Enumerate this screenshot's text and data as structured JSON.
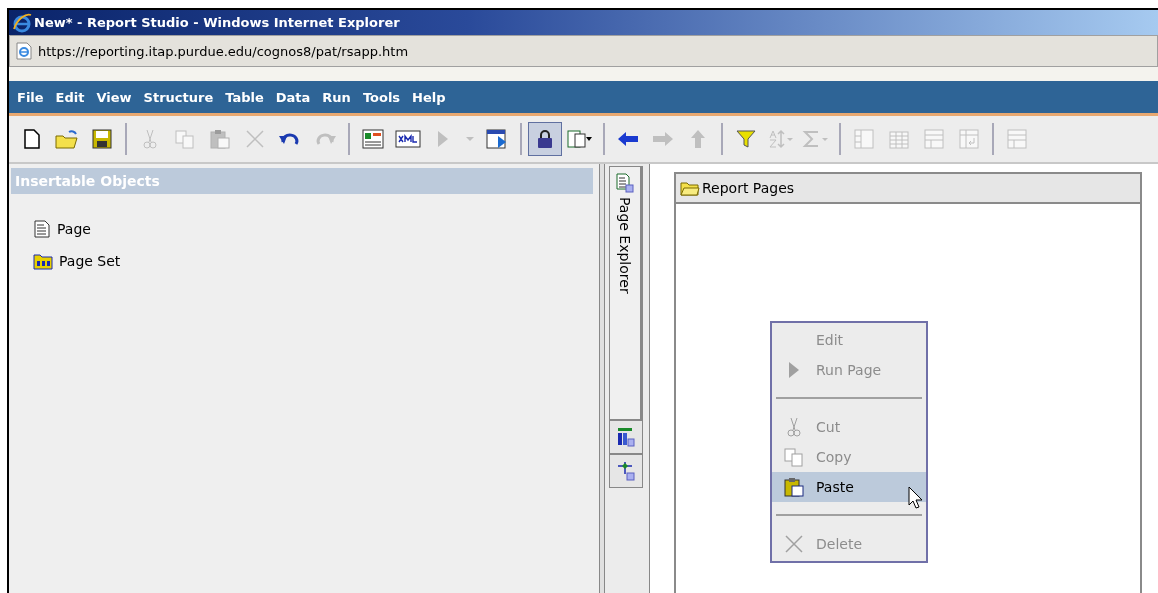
{
  "window": {
    "title": "New* - Report Studio - Windows Internet Explorer"
  },
  "address_bar": {
    "url": "https://reporting.itap.purdue.edu/cognos8/pat/rsapp.htm"
  },
  "menu_bar": [
    "File",
    "Edit",
    "View",
    "Structure",
    "Table",
    "Data",
    "Run",
    "Tools",
    "Help"
  ],
  "toolbar": [
    [
      {
        "kind": "new",
        "disabled": false
      },
      {
        "kind": "open",
        "disabled": false
      },
      {
        "kind": "save",
        "disabled": false
      }
    ],
    [
      {
        "kind": "cut",
        "disabled": true
      },
      {
        "kind": "copy",
        "disabled": true
      },
      {
        "kind": "paste",
        "disabled": true
      },
      {
        "kind": "delete",
        "disabled": true
      },
      {
        "kind": "undo",
        "disabled": false
      },
      {
        "kind": "redo",
        "disabled": true
      }
    ],
    [
      {
        "kind": "validate",
        "disabled": false
      },
      {
        "kind": "xml",
        "disabled": false
      },
      {
        "kind": "run",
        "disabled": true
      },
      {
        "kind": "dropdown",
        "disabled": true
      },
      {
        "kind": "view",
        "disabled": false
      }
    ],
    [
      {
        "kind": "lock",
        "disabled": false,
        "selected": true
      },
      {
        "kind": "layout",
        "disabled": false,
        "selected": false
      }
    ],
    [
      {
        "kind": "back",
        "disabled": false
      },
      {
        "kind": "forward",
        "disabled": true
      },
      {
        "kind": "up",
        "disabled": true
      }
    ],
    [
      {
        "kind": "filter",
        "disabled": false
      },
      {
        "kind": "sort",
        "disabled": true
      },
      {
        "kind": "sum",
        "disabled": true
      }
    ],
    [
      {
        "kind": "columns",
        "disabled": true
      },
      {
        "kind": "grid",
        "disabled": true
      },
      {
        "kind": "rows",
        "disabled": true
      },
      {
        "kind": "swap",
        "disabled": true
      }
    ],
    [
      {
        "kind": "rows",
        "disabled": true
      }
    ]
  ],
  "insertable_objects": {
    "title": "Insertable Objects",
    "items": [
      {
        "label": "Page",
        "kind": "page"
      },
      {
        "label": "Page Set",
        "kind": "pageset"
      }
    ]
  },
  "side_tabs": [
    {
      "label": "Page Explorer",
      "kind": "pages",
      "selected": true
    },
    {
      "kind": "queries",
      "selected": false
    },
    {
      "kind": "conditions",
      "selected": false
    }
  ],
  "report_pages": {
    "title": "Report Pages"
  },
  "context_menu": [
    {
      "kind": "edit",
      "label": "Edit",
      "disabled": true,
      "selected": false
    },
    {
      "kind": "run",
      "label": "Run Page",
      "disabled": true,
      "selected": false
    },
    {
      "kind": "separator"
    },
    {
      "kind": "cut",
      "label": "Cut",
      "disabled": true,
      "selected": false
    },
    {
      "kind": "copy",
      "label": "Copy",
      "disabled": true,
      "selected": false
    },
    {
      "kind": "paste",
      "label": "Paste",
      "disabled": false,
      "selected": true
    },
    {
      "kind": "separator"
    },
    {
      "kind": "delete",
      "label": "Delete",
      "disabled": true,
      "selected": false
    }
  ]
}
